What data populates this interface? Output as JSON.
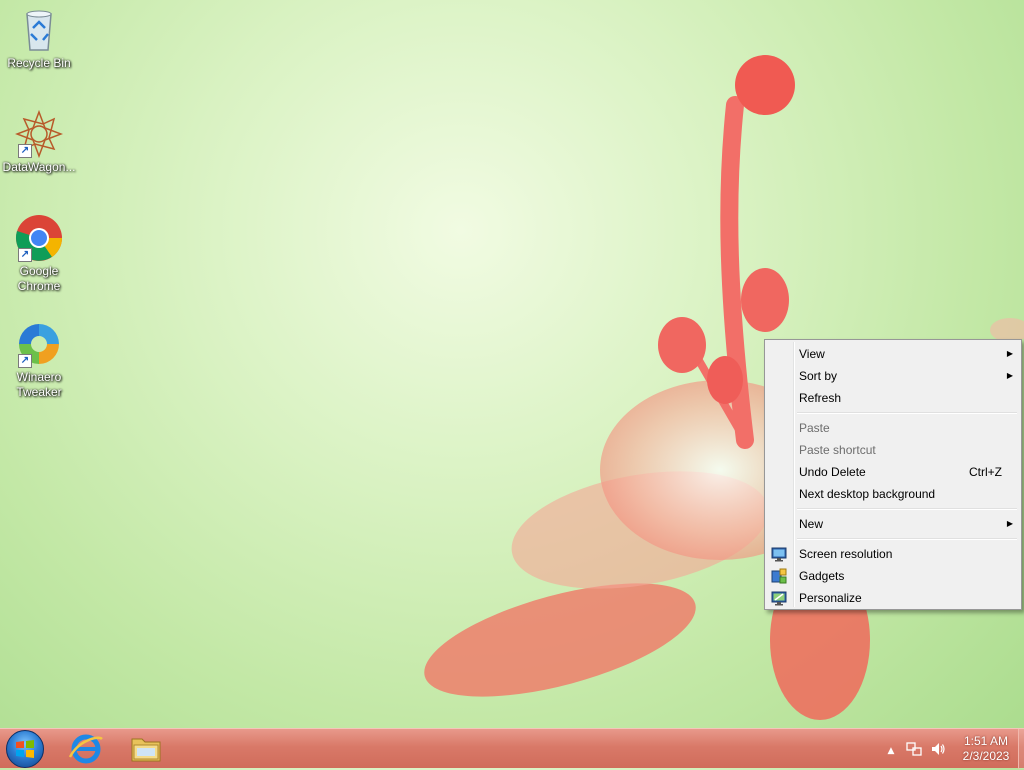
{
  "desktop": {
    "icons": [
      {
        "label": "Recycle Bin",
        "icon": "recycle-bin-icon"
      },
      {
        "label": "DataWagon...",
        "icon": "datawagon-icon"
      },
      {
        "label": "Google Chrome",
        "icon": "chrome-icon"
      },
      {
        "label": "Winaero Tweaker",
        "icon": "winaero-tweaker-icon"
      }
    ]
  },
  "context_menu": {
    "items": {
      "view": "View",
      "sort_by": "Sort by",
      "refresh": "Refresh",
      "paste": "Paste",
      "paste_shortcut": "Paste shortcut",
      "undo_delete": "Undo Delete",
      "undo_delete_accel": "Ctrl+Z",
      "next_background": "Next desktop background",
      "new": "New",
      "screen_resolution": "Screen resolution",
      "gadgets": "Gadgets",
      "personalize": "Personalize"
    },
    "submenu_arrow": "▶"
  },
  "taskbar": {
    "pinned": [
      {
        "icon": "internet-explorer-icon"
      },
      {
        "icon": "file-explorer-icon"
      }
    ],
    "tray": {
      "show_hidden": "▲",
      "time": "1:51 AM",
      "date": "2/3/2023"
    }
  },
  "colors": {
    "taskbar": "#d97968",
    "menu_bg": "#f0f0f0",
    "disabled_text": "#6d6d6d"
  }
}
